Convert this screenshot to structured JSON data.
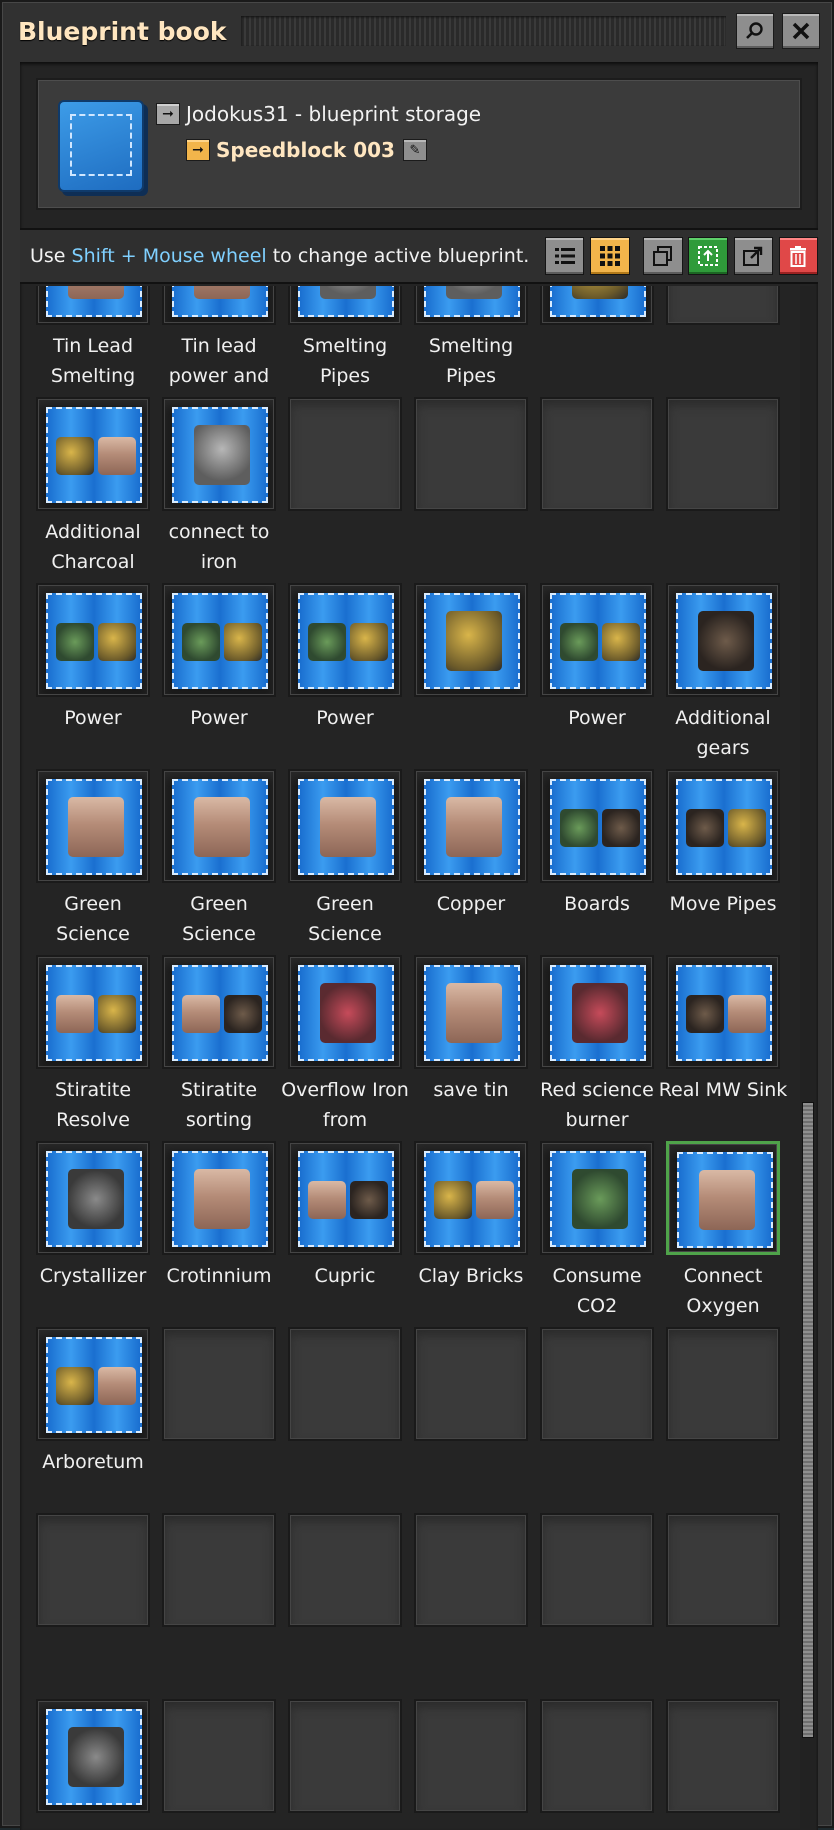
{
  "window": {
    "title": "Blueprint book"
  },
  "header": {
    "storage_label": "Jodokus31 - blueprint storage",
    "book_name": "Speedblock 003"
  },
  "toolbar": {
    "hint_prefix": "Use ",
    "hint_key": "Shift + Mouse wheel",
    "hint_suffix": " to change active blueprint."
  },
  "grid": {
    "rows": [
      {
        "cells": [
          {
            "label": "Tin Lead Smelting",
            "icons": [
              "brick"
            ],
            "filled": true
          },
          {
            "label": "Tin lead power and",
            "icons": [
              "brick"
            ],
            "filled": true
          },
          {
            "label": "Smelting Pipes",
            "icons": [
              "pipe"
            ],
            "filled": true
          },
          {
            "label": "Smelting Pipes",
            "icons": [
              "pipe"
            ],
            "filled": true
          },
          {
            "label": "",
            "icons": [
              "machine"
            ],
            "filled": true
          },
          {
            "label": "",
            "icons": [],
            "filled": false
          }
        ]
      },
      {
        "cells": [
          {
            "label": "Additional Charcoal",
            "icons": [
              "machine",
              "brick"
            ],
            "filled": true
          },
          {
            "label": "connect to iron",
            "icons": [
              "pipe"
            ],
            "filled": true
          },
          {
            "label": "",
            "icons": [],
            "filled": false
          },
          {
            "label": "",
            "icons": [],
            "filled": false
          },
          {
            "label": "",
            "icons": [],
            "filled": false
          },
          {
            "label": "",
            "icons": [],
            "filled": false
          }
        ]
      },
      {
        "cells": [
          {
            "label": "Power",
            "icons": [
              "green",
              "machine"
            ],
            "filled": true
          },
          {
            "label": "Power",
            "icons": [
              "green",
              "machine"
            ],
            "filled": true
          },
          {
            "label": "Power",
            "icons": [
              "green",
              "machine"
            ],
            "filled": true
          },
          {
            "label": "",
            "icons": [
              "machine"
            ],
            "filled": true
          },
          {
            "label": "Power",
            "icons": [
              "green",
              "machine"
            ],
            "filled": true
          },
          {
            "label": "Additional gears",
            "icons": [
              "dark"
            ],
            "filled": true
          }
        ]
      },
      {
        "cells": [
          {
            "label": "Green Science",
            "icons": [
              "brick"
            ],
            "filled": true
          },
          {
            "label": "Green Science",
            "icons": [
              "brick"
            ],
            "filled": true
          },
          {
            "label": "Green Science",
            "icons": [
              "brick"
            ],
            "filled": true
          },
          {
            "label": "Copper",
            "icons": [
              "brick"
            ],
            "filled": true
          },
          {
            "label": "Boards",
            "icons": [
              "green",
              "dark"
            ],
            "filled": true
          },
          {
            "label": "Move Pipes",
            "icons": [
              "dark",
              "machine"
            ],
            "filled": true
          }
        ]
      },
      {
        "cells": [
          {
            "label": "Stiratite Resolve",
            "icons": [
              "brick",
              "machine"
            ],
            "filled": true
          },
          {
            "label": "Stiratite sorting",
            "icons": [
              "brick",
              "dark"
            ],
            "filled": true
          },
          {
            "label": "Overflow Iron from",
            "icons": [
              "red"
            ],
            "filled": true
          },
          {
            "label": "save tin",
            "icons": [
              "brick"
            ],
            "filled": true
          },
          {
            "label": "Red science burner",
            "icons": [
              "red"
            ],
            "filled": true
          },
          {
            "label": "Real MW Sink",
            "icons": [
              "dark",
              "brick"
            ],
            "filled": true
          }
        ]
      },
      {
        "cells": [
          {
            "label": "Crystallizer",
            "icons": [
              "crystal"
            ],
            "filled": true
          },
          {
            "label": "Crotinnium",
            "icons": [
              "brick"
            ],
            "filled": true
          },
          {
            "label": "Cupric",
            "icons": [
              "brick",
              "dark"
            ],
            "filled": true
          },
          {
            "label": "Clay Bricks",
            "icons": [
              "machine",
              "brick"
            ],
            "filled": true
          },
          {
            "label": "Consume CO2",
            "icons": [
              "green"
            ],
            "filled": true
          },
          {
            "label": "Connect Oxygen",
            "icons": [
              "brick"
            ],
            "filled": true,
            "selected": true
          }
        ]
      },
      {
        "cells": [
          {
            "label": "Arboretum",
            "icons": [
              "machine",
              "brick"
            ],
            "filled": true
          },
          {
            "label": "",
            "icons": [],
            "filled": false
          },
          {
            "label": "",
            "icons": [],
            "filled": false
          },
          {
            "label": "",
            "icons": [],
            "filled": false
          },
          {
            "label": "",
            "icons": [],
            "filled": false
          },
          {
            "label": "",
            "icons": [],
            "filled": false
          }
        ]
      },
      {
        "cells": [
          {
            "label": "",
            "icons": [],
            "filled": false
          },
          {
            "label": "",
            "icons": [],
            "filled": false
          },
          {
            "label": "",
            "icons": [],
            "filled": false
          },
          {
            "label": "",
            "icons": [],
            "filled": false
          },
          {
            "label": "",
            "icons": [],
            "filled": false
          },
          {
            "label": "",
            "icons": [],
            "filled": false
          }
        ]
      },
      {
        "cells": [
          {
            "label": "",
            "icons": [
              "crystal"
            ],
            "filled": true
          },
          {
            "label": "",
            "icons": [],
            "filled": false
          },
          {
            "label": "",
            "icons": [],
            "filled": false
          },
          {
            "label": "",
            "icons": [],
            "filled": false
          },
          {
            "label": "",
            "icons": [],
            "filled": false
          },
          {
            "label": "",
            "icons": [],
            "filled": false
          }
        ]
      }
    ]
  },
  "icons": {
    "search_button": "search-icon",
    "close_button": "close-icon",
    "list_view": "list-view-icon",
    "grid_view": "grid-view-icon",
    "copy": "copy-icon",
    "select": "select-area-icon",
    "export": "export-icon",
    "delete": "trash-icon"
  },
  "colors": {
    "highlight": "#7fd0ff",
    "title": "#ffe6c0",
    "selected_border": "#4fa34a",
    "delete": "#e04848",
    "confirm": "#2f9b3a"
  }
}
